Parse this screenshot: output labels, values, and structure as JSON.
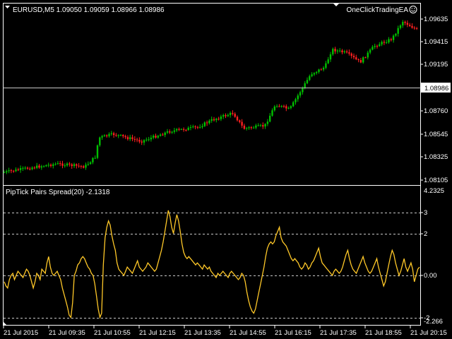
{
  "header": {
    "symbol_info": "EURUSD,M5  1.09050 1.09059 1.08966 1.08986",
    "ea_label": "OneClickTradingEA"
  },
  "main_chart": {
    "price_ticks": [
      "1.09635",
      "1.09415",
      "1.09195",
      "1.08760",
      "1.08545",
      "1.08325",
      "1.08105"
    ],
    "current_price_label": "1.08986",
    "bull_color": "#00c000",
    "bear_color": "#ff2020"
  },
  "indicator": {
    "title": "PipTick Pairs Spread(20) -2.1318",
    "line_color": "#ffc828",
    "ticks": [
      "4.2325",
      "3",
      "2",
      "0.00",
      "-2",
      "-2.266"
    ]
  },
  "time_axis": {
    "labels": [
      "21 Jul 2015",
      "21 Jul 09:35",
      "21 Jul 10:55",
      "21 Jul 12:15",
      "21 Jul 13:35",
      "21 Jul 14:55",
      "21 Jul 16:15",
      "21 Jul 17:35",
      "21 Jul 18:55",
      "21 Jul 20:15"
    ]
  },
  "chart_data": {
    "type": "line",
    "indicator_values": [
      -0.3,
      -0.5,
      -0.6,
      -0.2,
      0.0,
      0.1,
      -0.2,
      0.0,
      0.2,
      0.1,
      0.0,
      -0.1,
      0.1,
      0.3,
      0.2,
      0.0,
      -0.3,
      -0.6,
      -0.3,
      0.1,
      0.0,
      -0.2,
      0.3,
      0.2,
      0.1,
      0.6,
      0.9,
      0.4,
      0.1,
      0.0,
      0.1,
      0.2,
      0.0,
      -0.2,
      -0.6,
      -0.9,
      -1.2,
      -1.5,
      -1.9,
      -2.0,
      -1.3,
      0.0,
      0.2,
      0.5,
      0.6,
      0.8,
      0.9,
      0.8,
      0.6,
      0.4,
      0.3,
      0.1,
      0.0,
      -0.4,
      -1.0,
      -1.6,
      -2.0,
      -1.8,
      0.5,
      1.8,
      2.3,
      2.6,
      2.4,
      1.9,
      1.5,
      1.2,
      0.6,
      0.3,
      0.2,
      0.1,
      0.0,
      0.2,
      0.4,
      0.3,
      0.2,
      0.1,
      0.3,
      0.5,
      0.7,
      0.4,
      0.3,
      0.2,
      0.3,
      0.4,
      0.6,
      0.5,
      0.4,
      0.3,
      0.2,
      0.3,
      0.6,
      0.9,
      1.2,
      1.6,
      2.1,
      2.6,
      3.1,
      2.8,
      2.3,
      2.0,
      2.5,
      2.9,
      2.6,
      2.1,
      1.5,
      1.1,
      0.9,
      0.8,
      0.9,
      0.8,
      0.7,
      0.6,
      0.5,
      0.6,
      0.5,
      0.4,
      0.3,
      0.5,
      0.4,
      0.3,
      0.4,
      0.2,
      0.1,
      0.0,
      -0.1,
      0.1,
      0.0,
      0.1,
      0.2,
      0.1,
      0.0,
      -0.1,
      0.1,
      0.2,
      0.1,
      0.0,
      -0.1,
      -0.2,
      -0.1,
      0.1,
      0.0,
      -0.3,
      -0.8,
      -1.2,
      -1.5,
      -1.7,
      -1.8,
      -1.6,
      -1.2,
      -0.8,
      -0.4,
      0.0,
      0.4,
      0.9,
      1.3,
      1.5,
      1.6,
      1.5,
      1.6,
      1.9,
      2.1,
      2.3,
      1.8,
      1.6,
      1.5,
      1.4,
      1.2,
      1.0,
      0.8,
      0.7,
      0.8,
      0.7,
      0.6,
      0.4,
      0.3,
      0.4,
      0.6,
      0.5,
      0.3,
      0.4,
      0.6,
      0.7,
      0.9,
      1.1,
      1.3,
      0.9,
      0.6,
      0.5,
      0.4,
      0.3,
      0.2,
      0.1,
      0.0,
      0.2,
      0.3,
      0.2,
      0.1,
      0.2,
      0.4,
      0.7,
      1.0,
      1.2,
      0.8,
      0.5,
      0.3,
      0.2,
      0.1,
      0.3,
      0.5,
      0.7,
      0.9,
      0.6,
      0.4,
      0.2,
      0.1,
      0.2,
      0.4,
      0.6,
      0.8,
      0.4,
      0.1,
      -0.2,
      -0.5,
      -0.3,
      0.1,
      0.5,
      0.9,
      1.2,
      1.0,
      0.6,
      0.3,
      0.0,
      0.2,
      0.5,
      0.8,
      0.4,
      0.2,
      0.4,
      0.6,
      0.3,
      -0.3,
      0.0,
      0.3,
      0.4
    ]
  }
}
